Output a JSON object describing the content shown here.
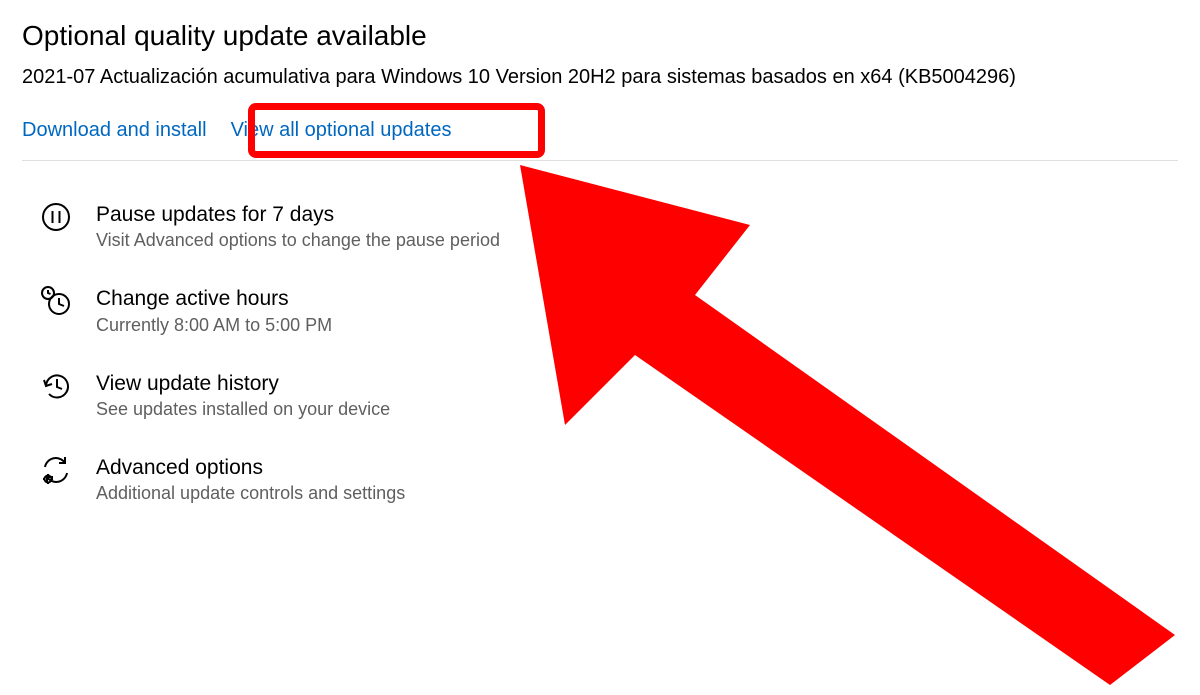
{
  "header": {
    "title": "Optional quality update available",
    "update_name": "2021-07 Actualización acumulativa para Windows 10 Version 20H2 para sistemas basados en x64 (KB5004296)"
  },
  "links": {
    "download_install": "Download and install",
    "view_all": "View all optional updates"
  },
  "options": [
    {
      "title": "Pause updates for 7 days",
      "subtitle": "Visit Advanced options to change the pause period"
    },
    {
      "title": "Change active hours",
      "subtitle": "Currently 8:00 AM to 5:00 PM"
    },
    {
      "title": "View update history",
      "subtitle": "See updates installed on your device"
    },
    {
      "title": "Advanced options",
      "subtitle": "Additional update controls and settings"
    }
  ],
  "annotation": {
    "highlight_color": "#ff0000"
  }
}
